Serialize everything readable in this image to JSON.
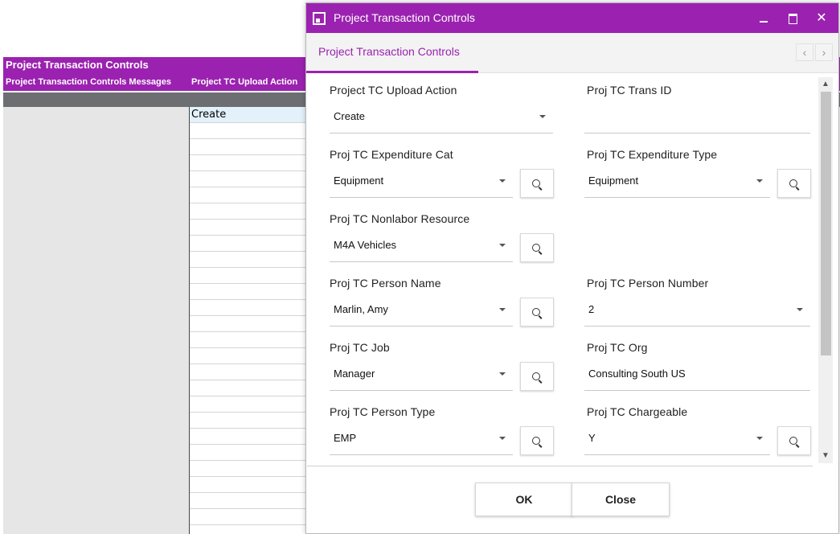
{
  "sheet": {
    "title": "Project Transaction Controls",
    "headers": [
      "Project Transaction Controls Messages",
      "Project TC Upload Action"
    ],
    "first_value": "Create"
  },
  "dialog": {
    "title": "Project Transaction Controls",
    "tab_label": "Project Transaction Controls",
    "fields": {
      "upload_action": {
        "label": "Project TC Upload Action",
        "value": "Create"
      },
      "trans_id": {
        "label": "Proj TC Trans ID",
        "value": ""
      },
      "expenditure_cat": {
        "label": "Proj TC Expenditure Cat",
        "value": "Equipment"
      },
      "expenditure_type": {
        "label": "Proj TC Expenditure Type",
        "value": "Equipment"
      },
      "nonlabor_resource": {
        "label": "Proj TC Nonlabor Resource",
        "value": "M4A Vehicles"
      },
      "person_name": {
        "label": "Proj TC Person Name",
        "value": "Marlin, Amy"
      },
      "person_number": {
        "label": "Proj TC Person Number",
        "value": "2"
      },
      "job": {
        "label": "Proj TC Job",
        "value": "Manager"
      },
      "org": {
        "label": "Proj TC Org",
        "value": "Consulting South US"
      },
      "person_type": {
        "label": "Proj TC Person Type",
        "value": "EMP"
      },
      "chargeable": {
        "label": "Proj TC Chargeable",
        "value": "Y"
      }
    },
    "buttons": {
      "ok": "OK",
      "close": "Close"
    },
    "window_controls": {
      "close_glyph": "✕"
    }
  },
  "icons": [
    "app-icon",
    "minimize-icon",
    "maximize-icon",
    "close-icon",
    "chevron-left-icon",
    "chevron-right-icon",
    "search-icon",
    "caret-down-icon",
    "scroll-up-icon",
    "scroll-down-icon"
  ],
  "colors": {
    "accent": "#9b22b0",
    "header_gray": "#6d6e71",
    "selected_cell": "#e3f1fb"
  }
}
